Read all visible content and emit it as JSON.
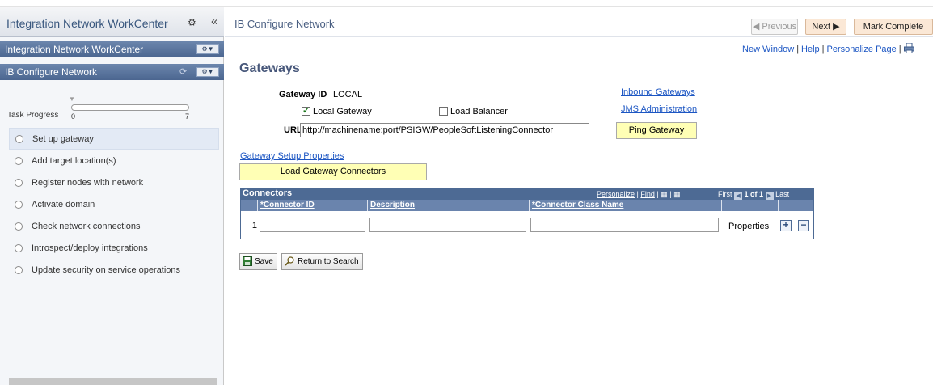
{
  "sidebar": {
    "title": "Integration Network WorkCenter",
    "pane1_title": "Integration Network WorkCenter",
    "pane2_title": "IB Configure Network",
    "task_progress_label": "Task Progress",
    "progress_min": "0",
    "progress_max": "7",
    "progress_value": 0,
    "steps": [
      "Set up gateway",
      "Add target location(s)",
      "Register nodes with network",
      "Activate domain",
      "Check network connections",
      "Introspect/deploy integrations",
      "Update security on service operations"
    ]
  },
  "header": {
    "page_name": "IB Configure Network",
    "previous_label": "Previous",
    "next_label": "Next",
    "mark_complete_label": "Mark Complete"
  },
  "toplinks": {
    "new_window": "New Window",
    "help": "Help",
    "personalize": "Personalize Page"
  },
  "page": {
    "heading": "Gateways",
    "gateway_id_label": "Gateway ID",
    "gateway_id_value": "LOCAL",
    "local_gateway_label": "Local Gateway",
    "local_gateway_checked": true,
    "load_balancer_label": "Load Balancer",
    "load_balancer_checked": false,
    "url_label": "URL",
    "url_value": "http://machinename:port/PSIGW/PeopleSoftListeningConnector",
    "inbound_gateways_link": "Inbound Gateways",
    "jms_admin_link": "JMS Administration",
    "ping_gateway_label": "Ping Gateway",
    "gateway_setup_link": "Gateway Setup Properties",
    "load_connectors_label": "Load Gateway Connectors"
  },
  "grid": {
    "title": "Connectors",
    "personalize": "Personalize",
    "find": "Find",
    "first": "First",
    "range": "1 of 1",
    "last": "Last",
    "columns": [
      "*Connector ID",
      "Description",
      "*Connector Class Name"
    ],
    "rows": [
      {
        "num": "1",
        "connector_id": "",
        "description": "",
        "class_name": "",
        "properties": "Properties"
      }
    ]
  },
  "footer": {
    "save_label": "Save",
    "return_label": "Return to Search"
  },
  "colors": {
    "grid_header": "#4d6a94",
    "button_yellow": "#ffffb5",
    "link": "#1c56c3"
  }
}
